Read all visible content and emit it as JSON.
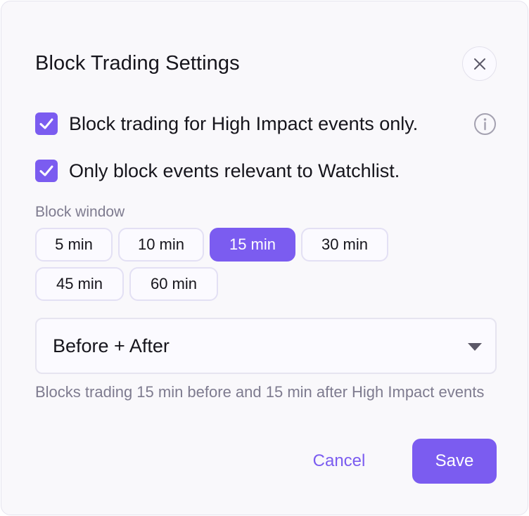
{
  "dialog": {
    "title": "Block Trading Settings",
    "close_icon": "close-icon"
  },
  "options": [
    {
      "label": "Block trading for High Impact events only.",
      "checked": true,
      "info_icon": "info-icon"
    },
    {
      "label": "Only block events relevant to Watchlist.",
      "checked": true
    }
  ],
  "block_window": {
    "label": "Block window",
    "chips": [
      "5 min",
      "10 min",
      "15 min",
      "30 min",
      "45 min",
      "60 min"
    ],
    "selected": "15 min"
  },
  "timing_select": {
    "value": "Before + After",
    "caret_icon": "caret-down-icon"
  },
  "help_text": "Blocks trading 15 min before and 15 min after High Impact events",
  "actions": {
    "cancel_label": "Cancel",
    "save_label": "Save"
  },
  "colors": {
    "accent": "#7b5cf0",
    "muted_text": "#7e7b8f",
    "background": "#f9f8fb"
  }
}
